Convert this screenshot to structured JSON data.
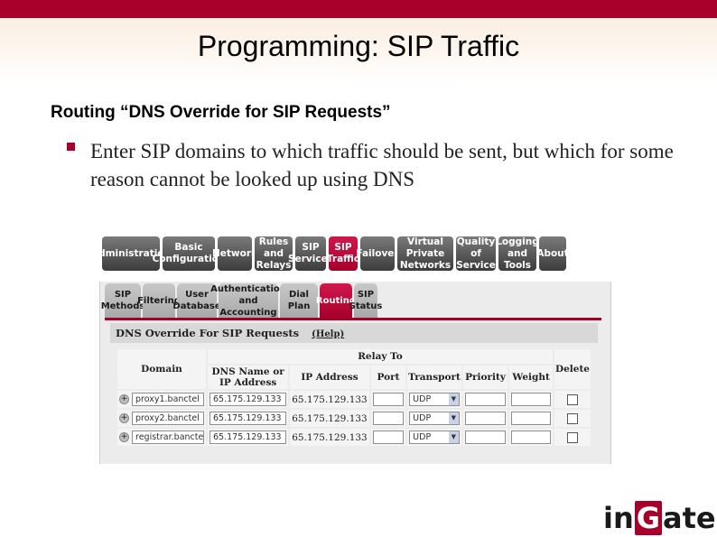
{
  "slide": {
    "title": "Programming: SIP Traffic",
    "subtitle": "Routing “DNS Override for SIP Requests”",
    "bullet": "Enter SIP domains to which traffic should be sent, but which for some reason cannot be looked up using DNS"
  },
  "topnav": [
    "Administration",
    "Basic Configuration",
    "Network",
    "Rules and Relays",
    "SIP Services",
    "SIP Traffic",
    "Failover",
    "Virtual Private Networks",
    "Quality of Service",
    "Logging and Tools",
    "About"
  ],
  "subtabs": [
    "SIP Methods",
    "Filtering",
    "User Database",
    "Authentication and Accounting",
    "Dial Plan",
    "Routing",
    "SIP Status"
  ],
  "section": {
    "title": "DNS Override For SIP Requests",
    "help": "(Help)"
  },
  "table": {
    "relay_to": "Relay To",
    "headers": {
      "domain": "Domain",
      "dns": "DNS Name or IP Address",
      "ip": "IP Address",
      "port": "Port",
      "transport": "Transport",
      "priority": "Priority",
      "weight": "Weight",
      "delete": "Delete"
    },
    "rows": [
      {
        "domain": "proxy1.banctel",
        "dns": "65.175.129.133",
        "ip": "65.175.129.133",
        "port": "",
        "transport": "UDP",
        "priority": "",
        "weight": ""
      },
      {
        "domain": "proxy2.banctel",
        "dns": "65.175.129.133",
        "ip": "65.175.129.133",
        "port": "",
        "transport": "UDP",
        "priority": "",
        "weight": ""
      },
      {
        "domain": "registrar.banctel",
        "dns": "65.175.129.133",
        "ip": "65.175.129.133",
        "port": "",
        "transport": "UDP",
        "priority": "",
        "weight": ""
      }
    ]
  },
  "logo": {
    "pre": "in",
    "box": "G",
    "post": "ate"
  },
  "colors": {
    "brand": "#a8002a"
  }
}
